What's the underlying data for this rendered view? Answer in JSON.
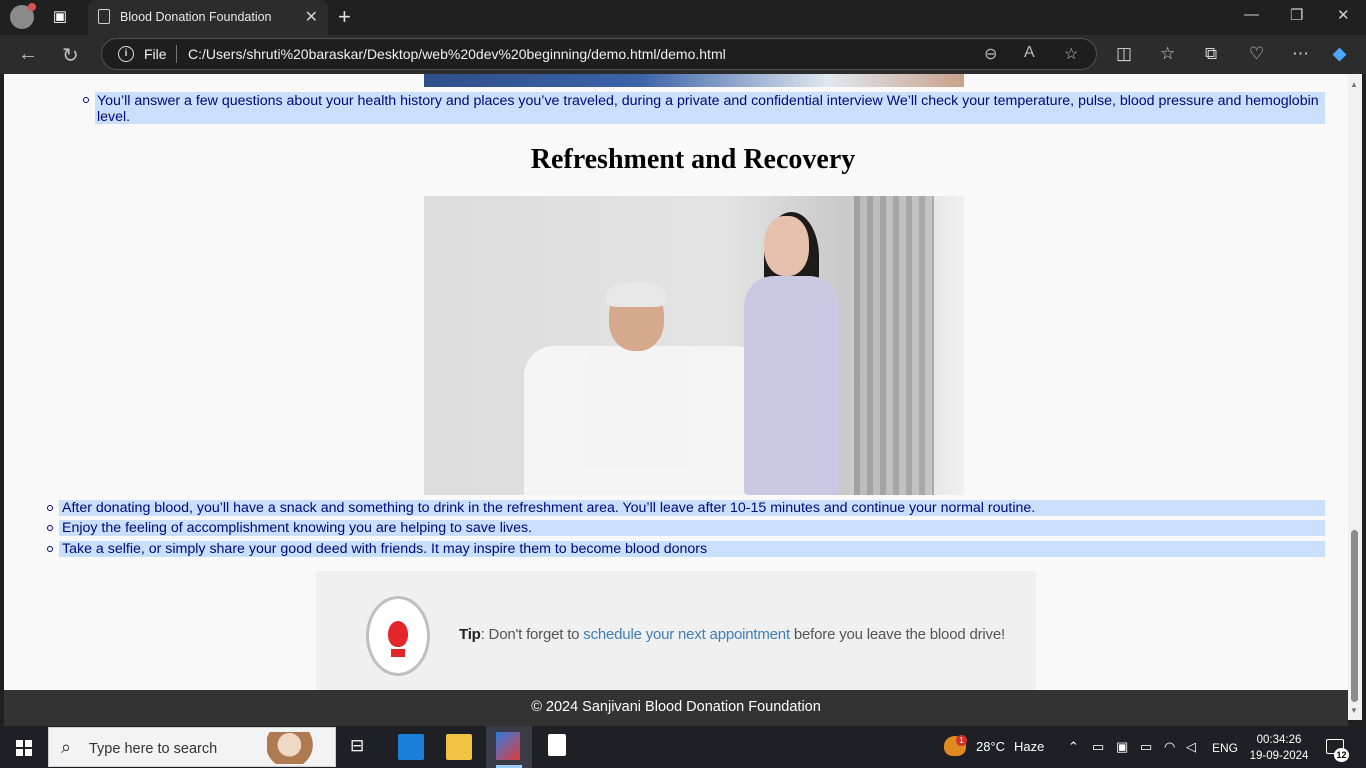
{
  "browser": {
    "tab_title": "Blood Donation Foundation",
    "address_scheme": "File",
    "address_url": "C:/Users/shruti%20baraskar/Desktop/web%20dev%20beginning/demo.html/demo.html"
  },
  "page": {
    "interview_item": "You’ll answer a few questions about your health history and places you’ve traveled, during a private and confidential interview We’ll check your temperature, pulse, blood pressure and hemoglobin level.",
    "recovery_heading": "Refreshment and Recovery",
    "recovery_items": [
      "After donating blood, you’ll have a snack and something to drink in the refreshment area. You’ll leave after 10-15 minutes and continue your normal routine.",
      "Enjoy the feeling of accomplishment knowing you are helping to save lives.",
      "Take a selfie, or simply share your good deed with friends. It may inspire them to become blood donors"
    ],
    "tip": {
      "label": "Tip",
      "before": ": Don't forget to ",
      "link": "schedule your next appointment",
      "after": " before you leave the blood drive!"
    },
    "footer": "© 2024 Sanjivani Blood Donation Foundation"
  },
  "taskbar": {
    "search_placeholder": "Type here to search",
    "weather_badge": "1",
    "temperature": "28°C",
    "weather": "Haze",
    "language": "ENG",
    "time": "00:34:26",
    "date": "19-09-2024",
    "notification_count": "12"
  }
}
